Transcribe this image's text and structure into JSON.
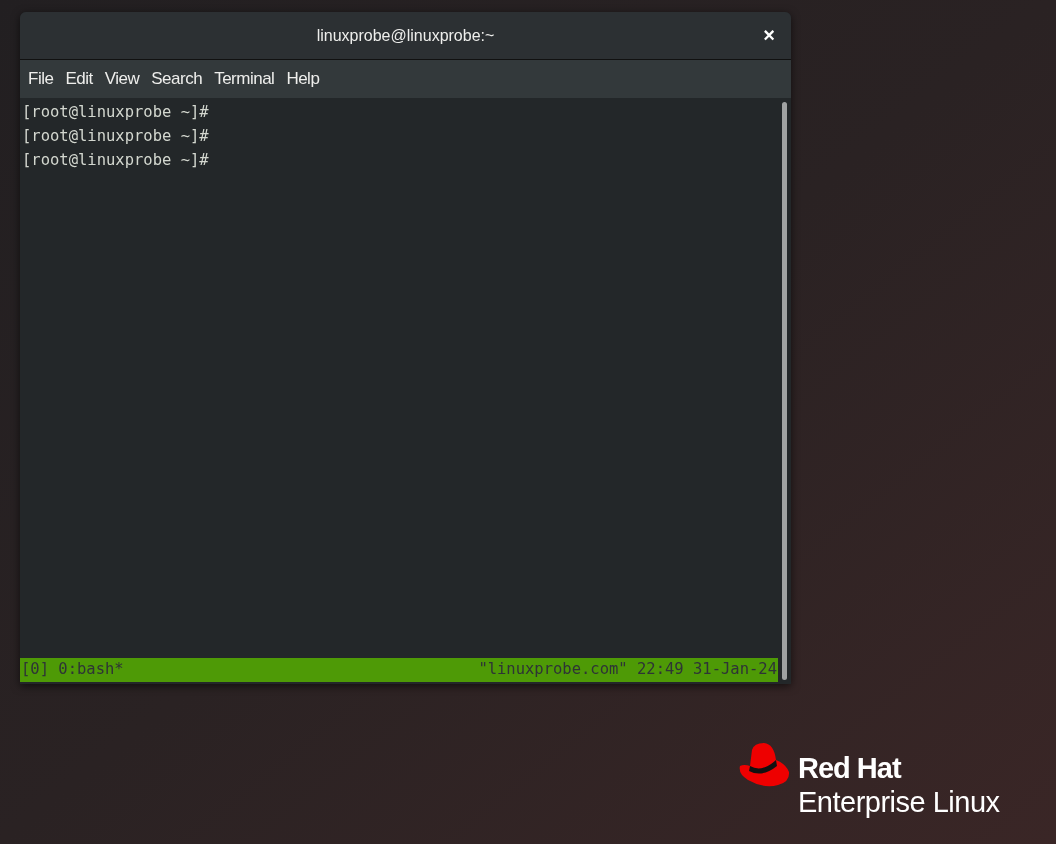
{
  "window": {
    "title": "linuxprobe@linuxprobe:~",
    "close": "×"
  },
  "menu": [
    "File",
    "Edit",
    "View",
    "Search",
    "Terminal",
    "Help"
  ],
  "terminal_lines": [
    "[root@linuxprobe ~]#",
    "[root@linuxprobe ~]#",
    "[root@linuxprobe ~]#"
  ],
  "status_bar": {
    "left": "[0] 0:bash*",
    "right": "\"linuxprobe.com\" 22:49 31-Jan-24"
  },
  "logo": {
    "brand": "Red Hat",
    "product": "Enterprise Linux"
  }
}
